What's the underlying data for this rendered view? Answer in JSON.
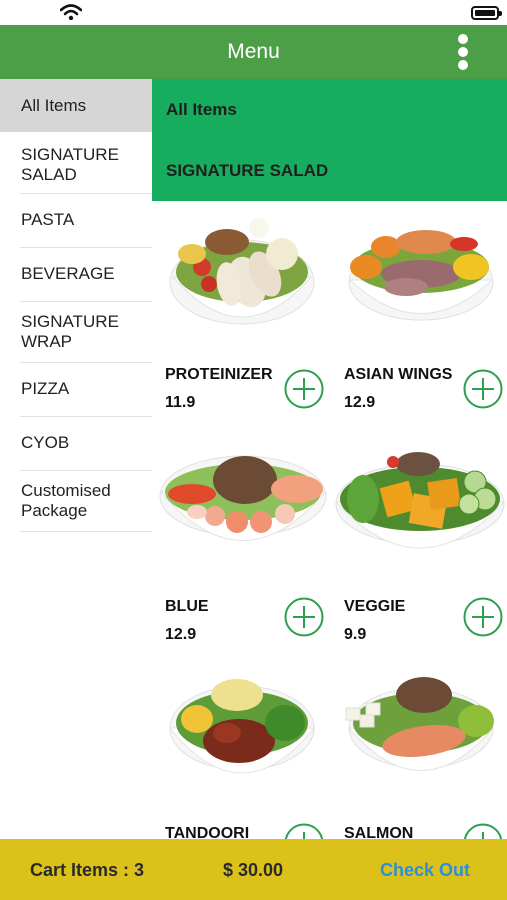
{
  "header": {
    "title": "Menu",
    "menu_icon": "more-vertical-icon"
  },
  "sidebar": {
    "items": [
      {
        "label": "All Items",
        "active": true
      },
      {
        "label": "SIGNATURE SALAD"
      },
      {
        "label": "PASTA"
      },
      {
        "label": "BEVERAGE"
      },
      {
        "label": "SIGNATURE WRAP"
      },
      {
        "label": "PIZZA"
      },
      {
        "label": "CYOB"
      },
      {
        "label": "Customised Package"
      }
    ]
  },
  "section": {
    "heading": "All Items",
    "subheading": "SIGNATURE SALAD"
  },
  "products": [
    {
      "name": "PROTEINIZER",
      "price": "11.9"
    },
    {
      "name": "ASIAN WINGS",
      "price": "12.9"
    },
    {
      "name": "BLUE",
      "price": "12.9"
    },
    {
      "name": "VEGGIE",
      "price": "9.9"
    },
    {
      "name": "TANDOORI",
      "price": ""
    },
    {
      "name": "SALMON",
      "price": ""
    }
  ],
  "cart": {
    "items_label": "Cart Items : 3",
    "total": "$ 30.00",
    "checkout_label": "Check Out"
  },
  "colors": {
    "app_bar": "#4c9e47",
    "category_panel": "#17ad5e",
    "cart_bar": "#dcc11b",
    "add_icon": "#2e9e4f",
    "checkout": "#2b8fd9"
  }
}
